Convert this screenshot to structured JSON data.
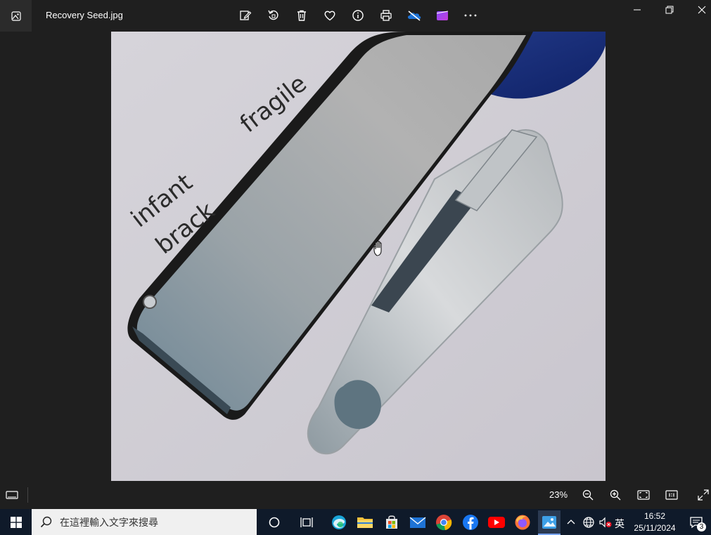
{
  "window": {
    "title": "Recovery Seed.jpg"
  },
  "toolbar": {
    "items": [
      "edit-icon",
      "rotate-icon",
      "delete-icon",
      "favorite-icon",
      "info-icon",
      "print-icon",
      "onedrive-icon",
      "clipchamp-icon",
      "more-icon"
    ]
  },
  "photo": {
    "word1": "fragile",
    "word2": "infant",
    "word3": "brack"
  },
  "bottombar": {
    "zoom": "23%"
  },
  "taskbar": {
    "search_placeholder": "在這裡輸入文字來搜尋",
    "time": "16:52",
    "date": "25/11/2024",
    "ime": "英",
    "notifications": "3"
  },
  "colors": {
    "accent": "#3b82f6",
    "taskbar": "#0f1a2a",
    "viewer_bg": "#1f1f1f"
  }
}
